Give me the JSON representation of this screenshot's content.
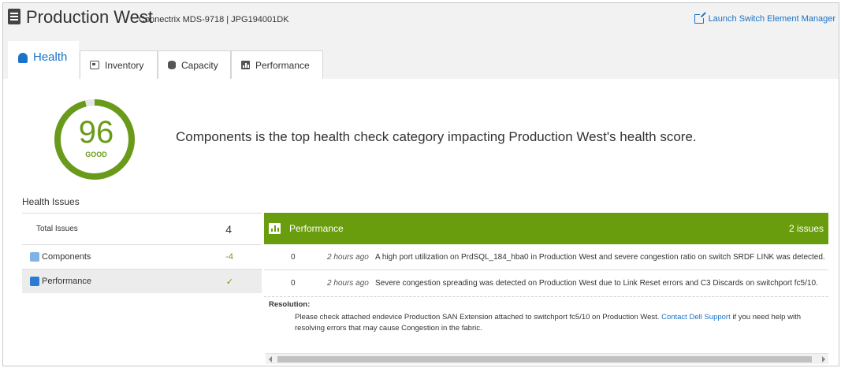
{
  "header": {
    "title": "Production West",
    "subtitle": "Connectrix MDS-9718 | JPG194001DK",
    "launch_label": "Launch Switch Element Manager"
  },
  "tabs": [
    {
      "label": "Health",
      "icon": "bell-icon",
      "active": true
    },
    {
      "label": "Inventory",
      "icon": "inventory-icon",
      "active": false
    },
    {
      "label": "Capacity",
      "icon": "database-icon",
      "active": false
    },
    {
      "label": "Performance",
      "icon": "bar-chart-icon",
      "active": false
    }
  ],
  "score": {
    "value": "96",
    "label": "GOOD",
    "fraction": 0.96,
    "color": "#6a9a1a"
  },
  "headline": "Components is the top health check category impacting Production West's health score.",
  "health_issues": {
    "title": "Health Issues",
    "total_label": "Total Issues",
    "total_value": "4",
    "categories": [
      {
        "label": "Components",
        "value": "-4",
        "icon": "components-icon",
        "icon_color": "#7fb3e6",
        "selected": false
      },
      {
        "label": "Performance",
        "value": "✓",
        "icon": "bar-chart-icon",
        "icon_color": "#2b7bd4",
        "selected": true
      }
    ]
  },
  "detail": {
    "category": "Performance",
    "count": "2 issues",
    "header_color": "#6a9d0d",
    "issues": [
      {
        "num": "0",
        "time": "2 hours ago",
        "message": "A high port utilization on PrdSQL_184_hba0 in Production West and severe congestion ratio on switch SRDF LINK was detected."
      },
      {
        "num": "0",
        "time": "2 hours ago",
        "message": "Severe congestion spreading was detected on Production West due to Link Reset errors and C3 Discards on switchport fc5/10."
      }
    ],
    "resolution_label": "Resolution:",
    "resolution_text_1": "Please check attached endevice Production SAN Extension attached to switchport fc5/10 on Production West. ",
    "resolution_link": "Contact Dell Support",
    "resolution_text_2": " if you need help with resolving errors that may cause Congestion in the fabric."
  }
}
